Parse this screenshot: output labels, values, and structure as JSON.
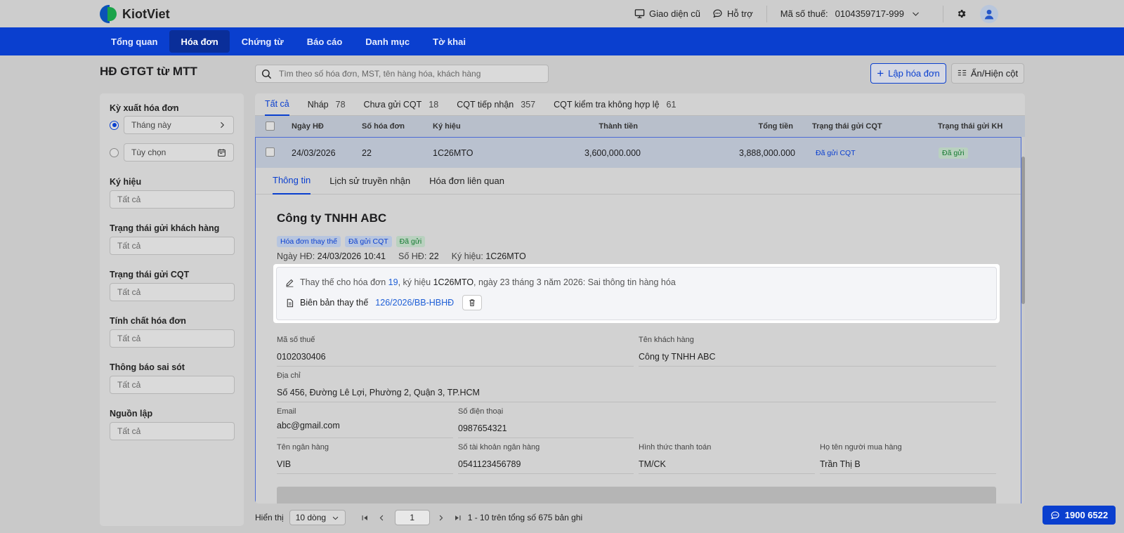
{
  "app": {
    "brand": "KiotViet",
    "accent": "#0a3fcf"
  },
  "topbar": {
    "old_ui": "Giao diện cũ",
    "support": "Hỗ trợ",
    "tax_label": "Mã số thuế:",
    "tax_value": "0104359717-999"
  },
  "nav": [
    "Tổng quan",
    "Hóa đơn",
    "Chứng từ",
    "Báo cáo",
    "Danh mục",
    "Tờ khai"
  ],
  "page": {
    "title": "HĐ GTGT từ MTT",
    "search_placeholder": "Tìm theo số hóa đơn, MST, tên hàng hóa, khách hàng",
    "create_button": "Lập hóa đơn",
    "columns_button": "Ẩn/Hiện cột"
  },
  "filters": {
    "period_label": "Kỳ xuất hóa đơn",
    "period_this_month": "Tháng này",
    "period_custom": "Tùy chọn",
    "symbol_label": "Ký hiệu",
    "customer_status_label": "Trạng thái gửi khách hàng",
    "cqt_status_label": "Trạng thái gửi CQT",
    "invoice_type_label": "Tính chất hóa đơn",
    "error_notice_label": "Thông báo sai sót",
    "source_label": "Nguồn lập",
    "all": "Tất cả"
  },
  "status_tabs": [
    {
      "label": "Tất cả",
      "count": ""
    },
    {
      "label": "Nháp",
      "count": "78"
    },
    {
      "label": "Chưa gửi CQT",
      "count": "18"
    },
    {
      "label": "CQT tiếp nhận",
      "count": "357"
    },
    {
      "label": "CQT kiểm tra không hợp lệ",
      "count": "61"
    }
  ],
  "table": {
    "headers": [
      "Ngày HĐ",
      "Số hóa đơn",
      "Ký hiệu",
      "Thành tiền",
      "Tổng tiền",
      "Trạng thái gửi CQT",
      "Trạng thái gửi KH"
    ],
    "row": {
      "date": "24/03/2026",
      "number": "22",
      "symbol": "1C26MTO",
      "amount": "3,600,000.000",
      "total": "3,888,000.000",
      "cqt_status": "Đã gửi CQT",
      "kh_status": "Đã gửi"
    }
  },
  "detail": {
    "tabs": [
      "Thông tin",
      "Lịch sử truyền nhận",
      "Hóa đơn liên quan"
    ],
    "company": "Công ty TNHH ABC",
    "badges": [
      "Hóa đơn thay thế",
      "Đã gửi CQT",
      "Đã gửi"
    ],
    "meta": {
      "date_label": "Ngày HĐ:",
      "date_value": "24/03/2026 10:41",
      "no_label": "Số HĐ:",
      "no_value": "22",
      "symbol_label": "Ký hiệu:",
      "symbol_value": "1C26MTO"
    },
    "note": {
      "replace_prefix": "Thay thế cho hóa đơn",
      "replace_invoice": "19",
      "replace_symbol_prefix": ", ký hiệu",
      "replace_symbol": "1C26MTO",
      "replace_suffix": ", ngày 23 tháng 3 năm 2026: Sai thông tin hàng hóa",
      "minutes_label": "Biên bản thay thế",
      "minutes_link": "126/2026/BB-HBHĐ"
    },
    "fields": {
      "tax_code_label": "Mã số thuế",
      "tax_code": "0102030406",
      "customer_name_label": "Tên khách hàng",
      "customer_name": "Công ty TNHH ABC",
      "address_label": "Địa chỉ",
      "address": "Số 456, Đường Lê Lợi, Phường 2, Quận 3, TP.HCM",
      "email_label": "Email",
      "email": "abc@gmail.com",
      "phone_label": "Số điện thoại",
      "phone": "0987654321",
      "bank_label": "Tên ngân hàng",
      "bank": "VIB",
      "account_label": "Số tài khoản ngân hàng",
      "account": "0541123456789",
      "payment_label": "Hình thức thanh toán",
      "payment": "TM/CK",
      "buyer_label": "Họ tên người mua hàng",
      "buyer": "Trần Thị B"
    }
  },
  "pager": {
    "show_label": "Hiển thị",
    "page_size": "10 dòng",
    "page": "1",
    "summary": "1 - 10 trên tổng số 675 bản ghi"
  },
  "hotline": "1900 6522"
}
